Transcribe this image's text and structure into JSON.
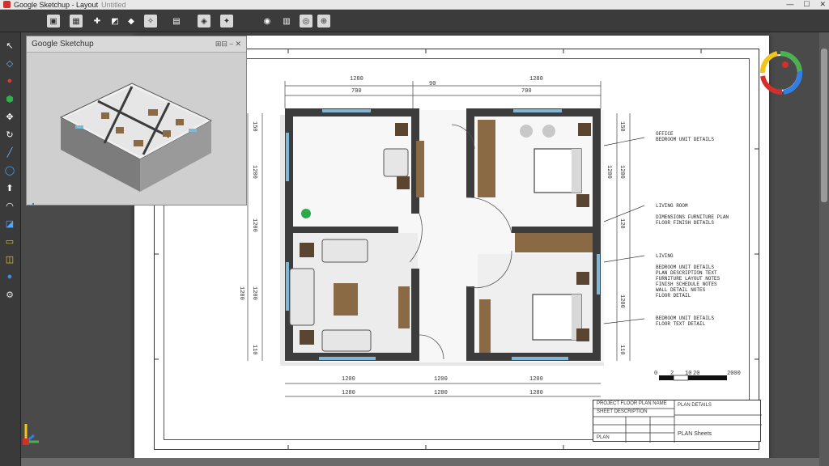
{
  "window": {
    "title": "Google Sketchup - Layout",
    "subtitle": "Untitled",
    "controls": [
      "—",
      "☐",
      "✕"
    ]
  },
  "toolbar": {
    "buttons": [
      {
        "name": "open-file-icon",
        "glyph": "▣"
      },
      {
        "name": "import-image-icon",
        "glyph": "▦"
      },
      {
        "name": "arrow-tool-icon",
        "glyph": "✚"
      },
      {
        "name": "chart-icon",
        "glyph": "◩"
      },
      {
        "name": "shapes-icon",
        "glyph": "◆"
      },
      {
        "name": "transform-icon",
        "glyph": "✧"
      },
      {
        "name": "layers-icon",
        "glyph": "▤"
      },
      {
        "name": "components-icon",
        "glyph": "◈"
      },
      {
        "name": "styles-icon",
        "glyph": "✦"
      },
      {
        "name": "materials-icon",
        "glyph": "◉"
      },
      {
        "name": "sections-icon",
        "glyph": "▥"
      },
      {
        "name": "scenes-icon",
        "glyph": "◎"
      },
      {
        "name": "target-icon",
        "glyph": "⊕"
      }
    ]
  },
  "tools": [
    {
      "name": "select-tool-icon",
      "glyph": "↖",
      "color": "#ffffff"
    },
    {
      "name": "eraser-tool-icon",
      "glyph": "◇",
      "color": "#6fb3ff"
    },
    {
      "name": "paint-bucket-icon",
      "glyph": "●",
      "color": "#e03a2f"
    },
    {
      "name": "push-pull-icon",
      "glyph": "⬢",
      "color": "#2fb04a"
    },
    {
      "name": "move-tool-icon",
      "glyph": "✥",
      "color": "#ffffff"
    },
    {
      "name": "rotate-tool-icon",
      "glyph": "↻",
      "color": "#ffffff"
    },
    {
      "name": "line-tool-icon",
      "glyph": "╱",
      "color": "#6fb3ff"
    },
    {
      "name": "circle-tool-icon",
      "glyph": "◯",
      "color": "#3fa9ff"
    },
    {
      "name": "up-arrow-icon",
      "glyph": "⬆",
      "color": "#ffffff"
    },
    {
      "name": "arc-tool-icon",
      "glyph": "◠",
      "color": "#ffffff"
    },
    {
      "name": "scale-tool-icon",
      "glyph": "◪",
      "color": "#4aa8ff"
    },
    {
      "name": "folder-icon",
      "glyph": "▭",
      "color": "#f2c417"
    },
    {
      "name": "tape-measure-icon",
      "glyph": "◫",
      "color": "#f2c417"
    },
    {
      "name": "globe-icon",
      "glyph": "●",
      "color": "#3a8ee6"
    },
    {
      "name": "settings-icon",
      "glyph": "⚙",
      "color": "#dddddd"
    }
  ],
  "thumbnail_panel": {
    "title": "Google Sketchup",
    "controls": "⊞⊟ ⎯ ✕"
  },
  "dimensions": {
    "top_row_outer": [
      "1280",
      "1280"
    ],
    "top_row_inner": [
      "700",
      "700"
    ],
    "top_row_small": "90",
    "bottom_row_inner": [
      "1200",
      "1200",
      "1200"
    ],
    "bottom_row_outer": [
      "1280",
      "1280",
      "1280"
    ],
    "left_col": [
      "150",
      "1200",
      "1200",
      "1280",
      "1200",
      "1200",
      "110"
    ],
    "right_col": [
      "150",
      "1200",
      "1200",
      "120",
      "1200",
      "110"
    ]
  },
  "notes": [
    {
      "title": "OFFICE",
      "body": "BEDROOM UNIT DETAILS"
    },
    {
      "title": "LIVING ROOM",
      "body": "DIMENSIONS FURNITURE PLAN\nFLOOR FINISH DETAILS"
    },
    {
      "title": "LIVING",
      "body": "BEDROOM UNIT DETAILS\nPLAN DESCRIPTION TEXT\nFURNITURE LAYOUT NOTES\nFINISH SCHEDULE NOTES\nWALL DETAIL NOTES\nFLOOR DETAIL"
    },
    {
      "title": "BEDROOM UNIT DETAILS",
      "body": "FLOOR TEXT DETAIL"
    }
  ],
  "scale_bar": {
    "labels": [
      "0",
      "2",
      "10",
      "20",
      "2000"
    ]
  },
  "title_block": {
    "rows": [
      "PROJECT FLOOR PLAN NAME",
      "SHEET DESCRIPTION",
      "",
      "",
      "PLAN"
    ],
    "right_label": "PLAN DETAILS",
    "bottom_right": "PLAN Sheets"
  },
  "colors": {
    "wall": "#3c3c3c",
    "wood": "#8a6a45",
    "window": "#7fb8d6",
    "accent_red": "#d2312a"
  }
}
